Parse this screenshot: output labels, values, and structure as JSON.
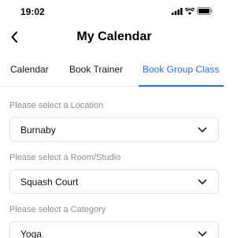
{
  "status": {
    "time": "19:02"
  },
  "nav": {
    "title": "My Calendar"
  },
  "tabs": [
    {
      "label": "Calendar"
    },
    {
      "label": "Book Trainer"
    },
    {
      "label": "Book Group Class",
      "active": true
    }
  ],
  "form": {
    "location": {
      "label": "Please select a Location",
      "value": "Burnaby"
    },
    "room": {
      "label": "Please select a Room/Studio",
      "value": "Squash Court"
    },
    "category": {
      "label": "Please select a Category",
      "value": "Yoga"
    }
  },
  "colors": {
    "accent": "#1e73e8",
    "muted_label": "#8e8e8e",
    "border": "#e3e3e3"
  },
  "icons": [
    "signal-icon",
    "wifi-icon",
    "battery-icon",
    "back-chevron-icon",
    "chevron-down-icon"
  ]
}
